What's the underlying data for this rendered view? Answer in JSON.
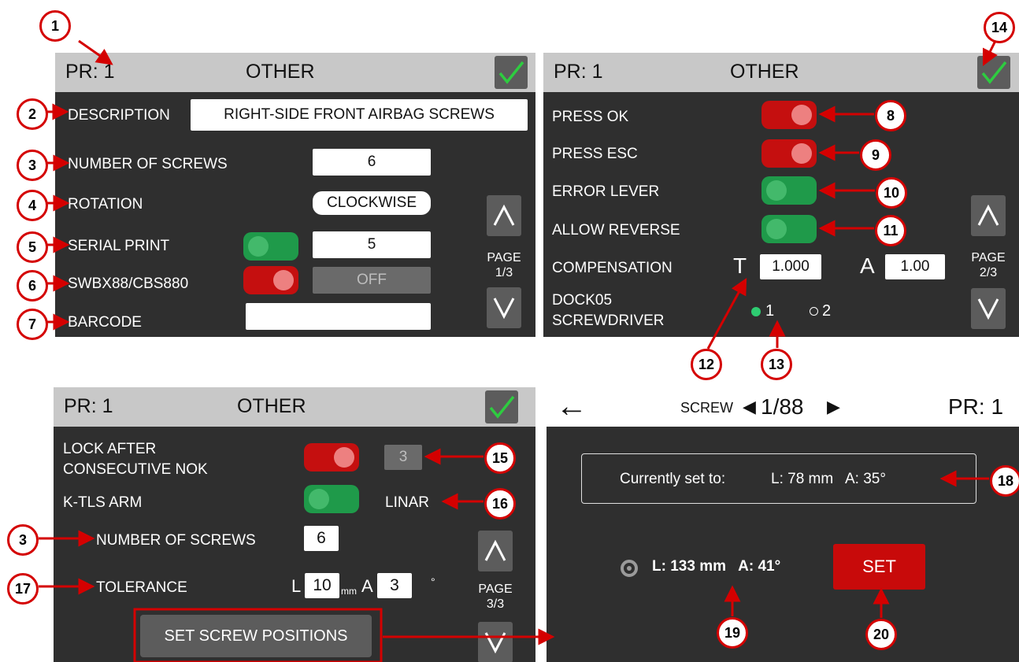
{
  "p1": {
    "pr": "PR: 1",
    "title": "OTHER",
    "description_label": "DESCRIPTION",
    "description_value": "RIGHT-SIDE FRONT AIRBAG  SCREWS",
    "screws_label": "NUMBER OF SCREWS",
    "screws_value": "6",
    "rotation_label": "ROTATION",
    "rotation_value": "CLOCKWISE",
    "serial_label": "SERIAL PRINT",
    "serial_value": "5",
    "swbx_label": "SWBX88/CBS880",
    "swbx_value": "OFF",
    "barcode_label": "BARCODE",
    "barcode_value": "",
    "page_label": "PAGE",
    "page_num": "1/3"
  },
  "p2": {
    "pr": "PR: 1",
    "title": "OTHER",
    "press_ok": "PRESS OK",
    "press_esc": "PRESS ESC",
    "error_lever": "ERROR LEVER",
    "allow_reverse": "ALLOW REVERSE",
    "compensation": "COMPENSATION",
    "t_letter": "T",
    "t_value": "1.000",
    "a_letter": "A",
    "a_value": "1.00",
    "dock_line1": "DOCK05",
    "dock_line2": "SCREWDRIVER",
    "radio1": "1",
    "radio2": "2",
    "page_label": "PAGE",
    "page_num": "2/3"
  },
  "p3": {
    "pr": "PR: 1",
    "title": "OTHER",
    "lock_line1": "LOCK AFTER",
    "lock_line2": "CONSECUTIVE NOK",
    "lock_value": "3",
    "ktls_label": "K-TLS ARM",
    "ktls_value": "LINAR",
    "screws_label": "NUMBER OF SCREWS",
    "screws_value": "6",
    "tolerance_label": "TOLERANCE",
    "l_letter": "L",
    "l_value": "10",
    "l_unit": "mm",
    "a_letter": "A",
    "a_value": "3",
    "a_unit": "°",
    "set_positions": "SET SCREW POSITIONS",
    "page_label": "PAGE",
    "page_num": "3/3"
  },
  "p4": {
    "back_glyph": "←",
    "screw_label": "SCREW",
    "prev_glyph": "◀",
    "screw_counter": "1/88",
    "next_glyph": "▶",
    "pr": "PR: 1",
    "currently_label": "Currently set to:",
    "currently_value": "L: 78 mm   A: 35°",
    "live_value": "L: 133 mm   A: 41°",
    "set_button": "SET"
  },
  "callouts": {
    "c1": "1",
    "c2": "2",
    "c3": "3",
    "c4": "4",
    "c5": "5",
    "c6": "6",
    "c7": "7",
    "c8": "8",
    "c9": "9",
    "c10": "10",
    "c11": "11",
    "c12": "12",
    "c13": "13",
    "c14": "14",
    "c15": "15",
    "c16": "16",
    "c17": "17",
    "c18": "18",
    "c19": "19",
    "c20": "20",
    "c3b": "3"
  },
  "colors": {
    "panel": "#2f2f2f",
    "header": "#c8c8c8",
    "toggle_red": "#c50f0f",
    "toggle_green": "#1f9a4a",
    "callout": "#d40000",
    "set_button": "#c80a0a"
  }
}
